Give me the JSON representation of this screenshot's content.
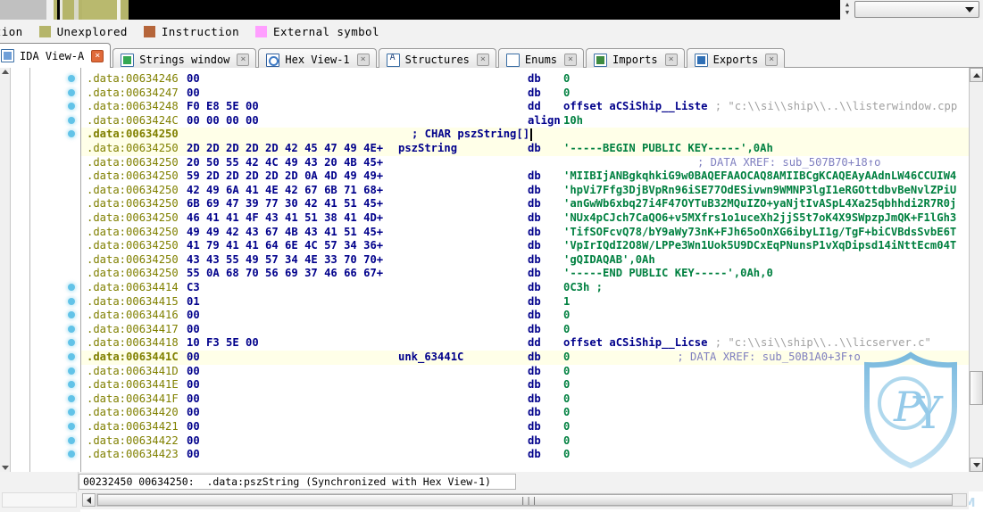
{
  "window": {
    "title": "IDA View-A",
    "combo_value": ""
  },
  "legend": {
    "items": [
      {
        "label": "nction",
        "color": ""
      },
      {
        "label": "Unexplored",
        "color": "#b5b56a"
      },
      {
        "label": "Instruction",
        "color": "#b5653a"
      },
      {
        "label": "External symbol",
        "color": "#ff9fff"
      }
    ]
  },
  "tabs": [
    {
      "label": "IDA View-A",
      "icon": "document-icon",
      "active": true,
      "close": "×"
    },
    {
      "label": "Strings window",
      "icon": "strings-icon",
      "active": false,
      "close": "×"
    },
    {
      "label": "Hex View-1",
      "icon": "hex-icon",
      "active": false,
      "close": "×"
    },
    {
      "label": "Structures",
      "icon": "structures-icon",
      "active": false,
      "close": "×"
    },
    {
      "label": "Enums",
      "icon": "enums-icon",
      "active": false,
      "close": "×"
    },
    {
      "label": "Imports",
      "icon": "imports-icon",
      "active": false,
      "close": "×"
    },
    {
      "label": "Exports",
      "icon": "exports-icon",
      "active": false,
      "close": "×"
    }
  ],
  "disassembly": {
    "rows": [
      {
        "addr": ".data:00634246",
        "hex": "00",
        "name": "",
        "mnem": "db",
        "operand": "0",
        "opclass": "c-num",
        "comment": "",
        "xref": "",
        "dot": true,
        "bold_addr": false
      },
      {
        "addr": ".data:00634247",
        "hex": "00",
        "name": "",
        "mnem": "db",
        "operand": "0",
        "opclass": "c-num",
        "comment": "",
        "xref": "",
        "dot": true,
        "bold_addr": false
      },
      {
        "addr": ".data:00634248",
        "hex": "F0 E8 5E 00",
        "name": "",
        "mnem": "dd",
        "operand": "offset aCSiShip__Liste",
        "opclass": "c-offs",
        "comment": "; \"c:\\\\si\\\\ship\\\\..\\\\listerwindow.cpp",
        "xref": "",
        "dot": true,
        "bold_addr": false
      },
      {
        "addr": ".data:0063424C",
        "hex": "00 00 00 00",
        "name": "",
        "mnem": "align",
        "operand": "10h",
        "opclass": "c-num",
        "comment": "",
        "xref": "",
        "dot": true,
        "bold_addr": false
      },
      {
        "addr": ".data:00634250",
        "hex": "",
        "name": "",
        "mnem": "",
        "operand": "",
        "opclass": "",
        "comment": "; CHAR pszString[]",
        "xref": "",
        "dot": true,
        "bold_addr": true,
        "chr_comment": true,
        "cursor": true
      },
      {
        "addr": ".data:00634250",
        "hex": "2D 2D 2D 2D 2D 42 45 47 49 4E+",
        "name": "pszString",
        "mnem": "db",
        "operand": "'-----BEGIN PUBLIC KEY-----',0Ah",
        "opclass": "c-str",
        "comment": "",
        "xref": "",
        "dot": false,
        "bold_addr": false
      },
      {
        "addr": ".data:00634250",
        "hex": "20 50 55 42 4C 49 43 20 4B 45+",
        "name": "",
        "mnem": "",
        "operand": "",
        "opclass": "",
        "comment": "",
        "xref": "; DATA XREF: sub_507B70+18↑o",
        "dot": false,
        "bold_addr": false
      },
      {
        "addr": ".data:00634250",
        "hex": "59 2D 2D 2D 2D 2D 0A 4D 49 49+",
        "name": "",
        "mnem": "db",
        "operand": "'MIIBIjANBgkqhkiG9w0BAQEFAAOCAQ8AMIIBCgKCAQEAyAAdnLW46CCUIW4",
        "opclass": "c-str",
        "comment": "",
        "xref": "",
        "dot": false,
        "bold_addr": false
      },
      {
        "addr": ".data:00634250",
        "hex": "42 49 6A 41 4E 42 67 6B 71 68+",
        "name": "",
        "mnem": "db",
        "operand": "'hpVi7Ffg3DjBVpRn96iSE77OdESivwn9WMNP3lgI1eRGOttdbvBeNvlZPiU",
        "opclass": "c-str",
        "comment": "",
        "xref": "",
        "dot": false,
        "bold_addr": false
      },
      {
        "addr": ".data:00634250",
        "hex": "6B 69 47 39 77 30 42 41 51 45+",
        "name": "",
        "mnem": "db",
        "operand": "'anGwWb6xbq27i4F47OYTuB32MQuIZO+yaNjtIvASpL4Xa25qbhhdi2R7R0j",
        "opclass": "c-str",
        "comment": "",
        "xref": "",
        "dot": false,
        "bold_addr": false
      },
      {
        "addr": ".data:00634250",
        "hex": "46 41 41 4F 43 41 51 38 41 4D+",
        "name": "",
        "mnem": "db",
        "operand": "'NUx4pCJch7CaQO6+v5MXfrs1o1uceXh2jjS5t7oK4X9SWpzpJmQK+F1lGh3",
        "opclass": "c-str",
        "comment": "",
        "xref": "",
        "dot": false,
        "bold_addr": false
      },
      {
        "addr": ".data:00634250",
        "hex": "49 49 42 43 67 4B 43 41 51 45+",
        "name": "",
        "mnem": "db",
        "operand": "'TifSOFcvQ78/bY9aWy73nK+FJh65oOnXG6ibyLI1g/TgF+biCVBdsSvbE6T",
        "opclass": "c-str",
        "comment": "",
        "xref": "",
        "dot": false,
        "bold_addr": false
      },
      {
        "addr": ".data:00634250",
        "hex": "41 79 41 41 64 6E 4C 57 34 36+",
        "name": "",
        "mnem": "db",
        "operand": "'VpIrIQdI2O8W/LPPe3Wn1Uok5U9DCxEqPNunsP1vXqDipsd14iNttEcm04T",
        "opclass": "c-str",
        "comment": "",
        "xref": "",
        "dot": false,
        "bold_addr": false
      },
      {
        "addr": ".data:00634250",
        "hex": "43 43 55 49 57 34 4E 33 70 70+",
        "name": "",
        "mnem": "db",
        "operand": "'gQIDAQAB',0Ah",
        "opclass": "c-str",
        "comment": "",
        "xref": "",
        "dot": false,
        "bold_addr": false
      },
      {
        "addr": ".data:00634250",
        "hex": "55 0A 68 70 56 69 37 46 66 67+",
        "name": "",
        "mnem": "db",
        "operand": "'-----END PUBLIC KEY-----',0Ah,0",
        "opclass": "c-str",
        "comment": "",
        "xref": "",
        "dot": false,
        "bold_addr": false
      },
      {
        "addr": ".data:00634414",
        "hex": "C3",
        "name": "",
        "mnem": "db",
        "operand": "0C3h ;",
        "opclass": "c-num",
        "comment": "",
        "xref": "",
        "dot": true,
        "bold_addr": false
      },
      {
        "addr": ".data:00634415",
        "hex": "01",
        "name": "",
        "mnem": "db",
        "operand": "1",
        "opclass": "c-num",
        "comment": "",
        "xref": "",
        "dot": true,
        "bold_addr": false
      },
      {
        "addr": ".data:00634416",
        "hex": "00",
        "name": "",
        "mnem": "db",
        "operand": "0",
        "opclass": "c-num",
        "comment": "",
        "xref": "",
        "dot": true,
        "bold_addr": false
      },
      {
        "addr": ".data:00634417",
        "hex": "00",
        "name": "",
        "mnem": "db",
        "operand": "0",
        "opclass": "c-num",
        "comment": "",
        "xref": "",
        "dot": true,
        "bold_addr": false
      },
      {
        "addr": ".data:00634418",
        "hex": "10 F3 5E 00",
        "name": "",
        "mnem": "dd",
        "operand": "offset aCSiShip__Licse",
        "opclass": "c-offs",
        "comment": "; \"c:\\\\si\\\\ship\\\\..\\\\licserver.c\"",
        "xref": "",
        "dot": true,
        "bold_addr": false
      },
      {
        "addr": ".data:0063441C",
        "hex": "00",
        "name": "unk_63441C",
        "mnem": "db",
        "operand": "0",
        "opclass": "c-num",
        "comment": "",
        "xref": "; DATA XREF: sub_50B1A0+3F↑o",
        "dot": true,
        "bold_addr": true
      },
      {
        "addr": ".data:0063441D",
        "hex": "00",
        "name": "",
        "mnem": "db",
        "operand": "0",
        "opclass": "c-num",
        "comment": "",
        "xref": "",
        "dot": true,
        "bold_addr": false
      },
      {
        "addr": ".data:0063441E",
        "hex": "00",
        "name": "",
        "mnem": "db",
        "operand": "0",
        "opclass": "c-num",
        "comment": "",
        "xref": "",
        "dot": true,
        "bold_addr": false
      },
      {
        "addr": ".data:0063441F",
        "hex": "00",
        "name": "",
        "mnem": "db",
        "operand": "0",
        "opclass": "c-num",
        "comment": "",
        "xref": "",
        "dot": true,
        "bold_addr": false
      },
      {
        "addr": ".data:00634420",
        "hex": "00",
        "name": "",
        "mnem": "db",
        "operand": "0",
        "opclass": "c-num",
        "comment": "",
        "xref": "",
        "dot": true,
        "bold_addr": false
      },
      {
        "addr": ".data:00634421",
        "hex": "00",
        "name": "",
        "mnem": "db",
        "operand": "0",
        "opclass": "c-num",
        "comment": "",
        "xref": "",
        "dot": true,
        "bold_addr": false
      },
      {
        "addr": ".data:00634422",
        "hex": "00",
        "name": "",
        "mnem": "db",
        "operand": "0",
        "opclass": "c-num",
        "comment": "",
        "xref": "",
        "dot": true,
        "bold_addr": false
      },
      {
        "addr": ".data:00634423",
        "hex": "00",
        "name": "",
        "mnem": "db",
        "operand": "0",
        "opclass": "c-num",
        "comment": "",
        "xref": "",
        "dot": true,
        "bold_addr": false
      }
    ]
  },
  "status": {
    "offset": "00232450",
    "text": "00232450 00634250:  .data:pszString (Synchronized with Hex View-1)"
  },
  "watermark": {
    "text": "BBS.CHINAPYG.COM",
    "logo_letters": "PY",
    "color": "#8dc6e8"
  }
}
